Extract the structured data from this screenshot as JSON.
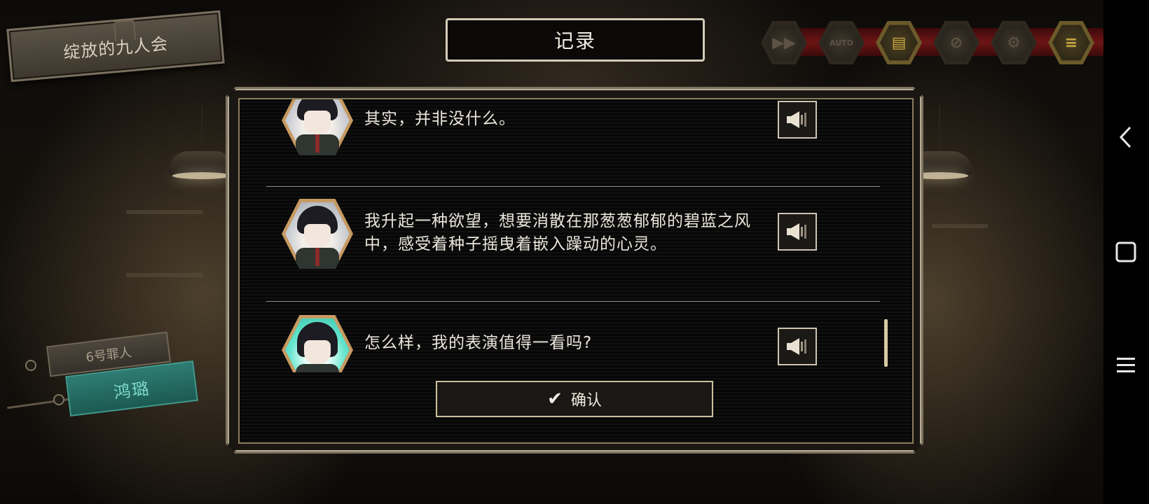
{
  "background": {
    "chapter_title": "绽放的九人会"
  },
  "record": {
    "title": "记录"
  },
  "toolbar": {
    "buttons": [
      {
        "name": "skip",
        "icon": "fast-forward-icon",
        "glyph": "▶▶",
        "active": false
      },
      {
        "name": "auto",
        "icon": "auto-icon",
        "glyph": "AUTO",
        "active": false
      },
      {
        "name": "log",
        "icon": "log-book-icon",
        "glyph": "▤",
        "active": true
      },
      {
        "name": "hide-ui",
        "icon": "no-eye-icon",
        "glyph": "⊘",
        "active": false
      },
      {
        "name": "settings",
        "icon": "gear-icon",
        "glyph": "⚙",
        "active": false
      },
      {
        "name": "menu",
        "icon": "menu-icon",
        "glyph": "≡",
        "active": true
      }
    ]
  },
  "character_tag": {
    "role": "6号罪人",
    "name": "鸿璐"
  },
  "log": {
    "entries": [
      {
        "portrait": "boy-black-hair",
        "text": "其实，并非没什么。"
      },
      {
        "portrait": "boy-black-hair",
        "text": "我升起一种欲望，想要消散在那葱葱郁郁的碧蓝之风中，感受着种子摇曳着嵌入躁动的心灵。"
      },
      {
        "portrait": "girl-teal-background",
        "text": "怎么样，我的表演值得一看吗?"
      }
    ],
    "voice_icon": "speaker-icon"
  },
  "confirm": {
    "label": "确认",
    "icon": "check-icon"
  },
  "nav": {
    "back_icon": "back-icon",
    "home_icon": "home-square-icon",
    "recent_icon": "recent-apps-icon"
  }
}
